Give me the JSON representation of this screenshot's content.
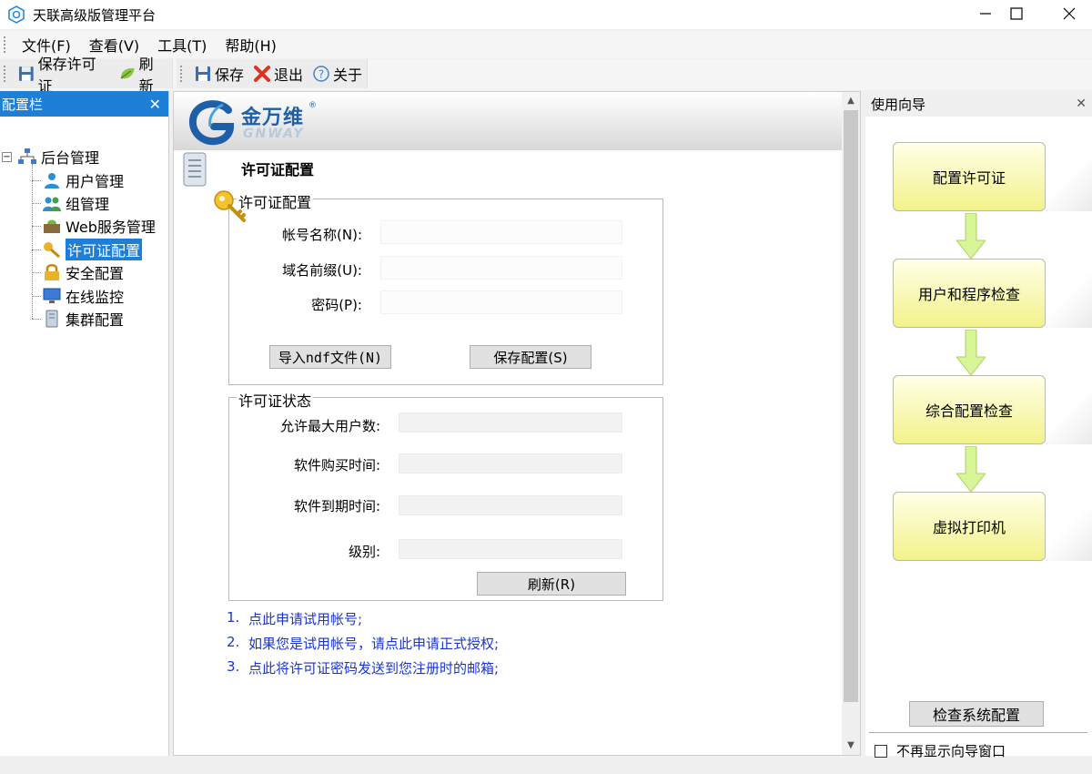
{
  "window": {
    "title": "天联高级版管理平台"
  },
  "menubar": {
    "items": [
      "文件(F)",
      "查看(V)",
      "工具(T)",
      "帮助(H)"
    ]
  },
  "toolbar": {
    "group1": {
      "save_license": "保存许可证",
      "refresh": "刷新"
    },
    "group2": {
      "save": "保存",
      "exit": "退出",
      "about": "关于"
    }
  },
  "left_panel": {
    "title": "配置栏",
    "tree": {
      "root": "后台管理",
      "children": [
        "用户管理",
        "组管理",
        "Web服务管理",
        "许可证配置",
        "安全配置",
        "在线监控",
        "集群配置"
      ],
      "selected": "许可证配置"
    }
  },
  "main": {
    "logo_cn": "金万维",
    "logo_en": "GNWAY",
    "page_title": "许可证配置",
    "license_config": {
      "legend": "许可证配置",
      "account_label": "帐号名称(N):",
      "account_value": "",
      "domain_label": "域名前缀(U):",
      "domain_value": "",
      "password_label": "密码(P):",
      "password_value": "",
      "import_button": "导入ndf文件(N)",
      "save_button": "保存配置(S)"
    },
    "license_status": {
      "legend": "许可证状态",
      "max_users_label": "允许最大用户数:",
      "purchase_time_label": "软件购买时间:",
      "expire_time_label": "软件到期时间:",
      "level_label": "级别:",
      "refresh_button": "刷新(R)"
    },
    "links": [
      {
        "num": "1.",
        "text": "点此申请试用帐号;"
      },
      {
        "num": "2.",
        "text": "如果您是试用帐号，请点此申请正式授权;"
      },
      {
        "num": "3.",
        "text": "点此将许可证密码发送到您注册时的邮箱;"
      }
    ]
  },
  "right_panel": {
    "title": "使用向导",
    "steps": [
      "配置许可证",
      "用户和程序检查",
      "综合配置检查",
      "虚拟打印机"
    ],
    "check_button": "检查系统配置",
    "dont_show_label": "不再显示向导窗口"
  },
  "colors": {
    "accent": "#1e7fd6",
    "link": "#1a36c8",
    "step_fill": "#f2f28a"
  }
}
